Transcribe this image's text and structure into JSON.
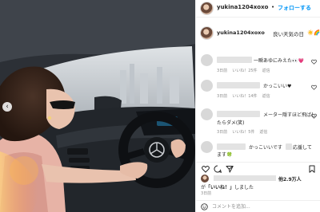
{
  "post": {
    "username": "yukina1204xoxo",
    "follow_label": "フォローする",
    "dot": "•",
    "caption_text": "良い天気の日",
    "caption_emoji": "☀️🌈",
    "photo_prev_icon": "chevron-left-icon"
  },
  "comments": [
    {
      "text": "一瞬あゆにみえた👀💗",
      "meta": {
        "time": "3日前",
        "likes": "いいね！25件",
        "reply": "返信"
      }
    },
    {
      "text": "かっこいい♥",
      "meta": {
        "time": "3日前",
        "likes": "いいね！14件",
        "reply": "返信"
      }
    },
    {
      "text_line1": "メーター隠すほど飛ばし",
      "text_line2": "たらダメ(笑)",
      "meta": {
        "time": "3日前",
        "likes": "いいね！5件",
        "reply": "返信"
      }
    },
    {
      "text_part1": "かっこいいです",
      "text_part2": "応援して",
      "text_line2": "ます🍀"
    }
  ],
  "actions": {
    "like_icon": "heart-icon",
    "comment_icon": "comment-icon",
    "share_icon": "share-icon",
    "save_icon": "bookmark-icon"
  },
  "likes": {
    "count_text": "他2.9万人",
    "line2_prefix": "が",
    "line2_bold": "「いいね！」",
    "line2_suffix": "しました"
  },
  "post_time": "3日前",
  "add_comment": {
    "placeholder": "コメントを追加...",
    "emoji_icon": "smile-icon"
  },
  "colors": {
    "accent": "#0095f6",
    "text": "#262626",
    "muted": "#8e8e8e",
    "heart": "#ed4956"
  }
}
